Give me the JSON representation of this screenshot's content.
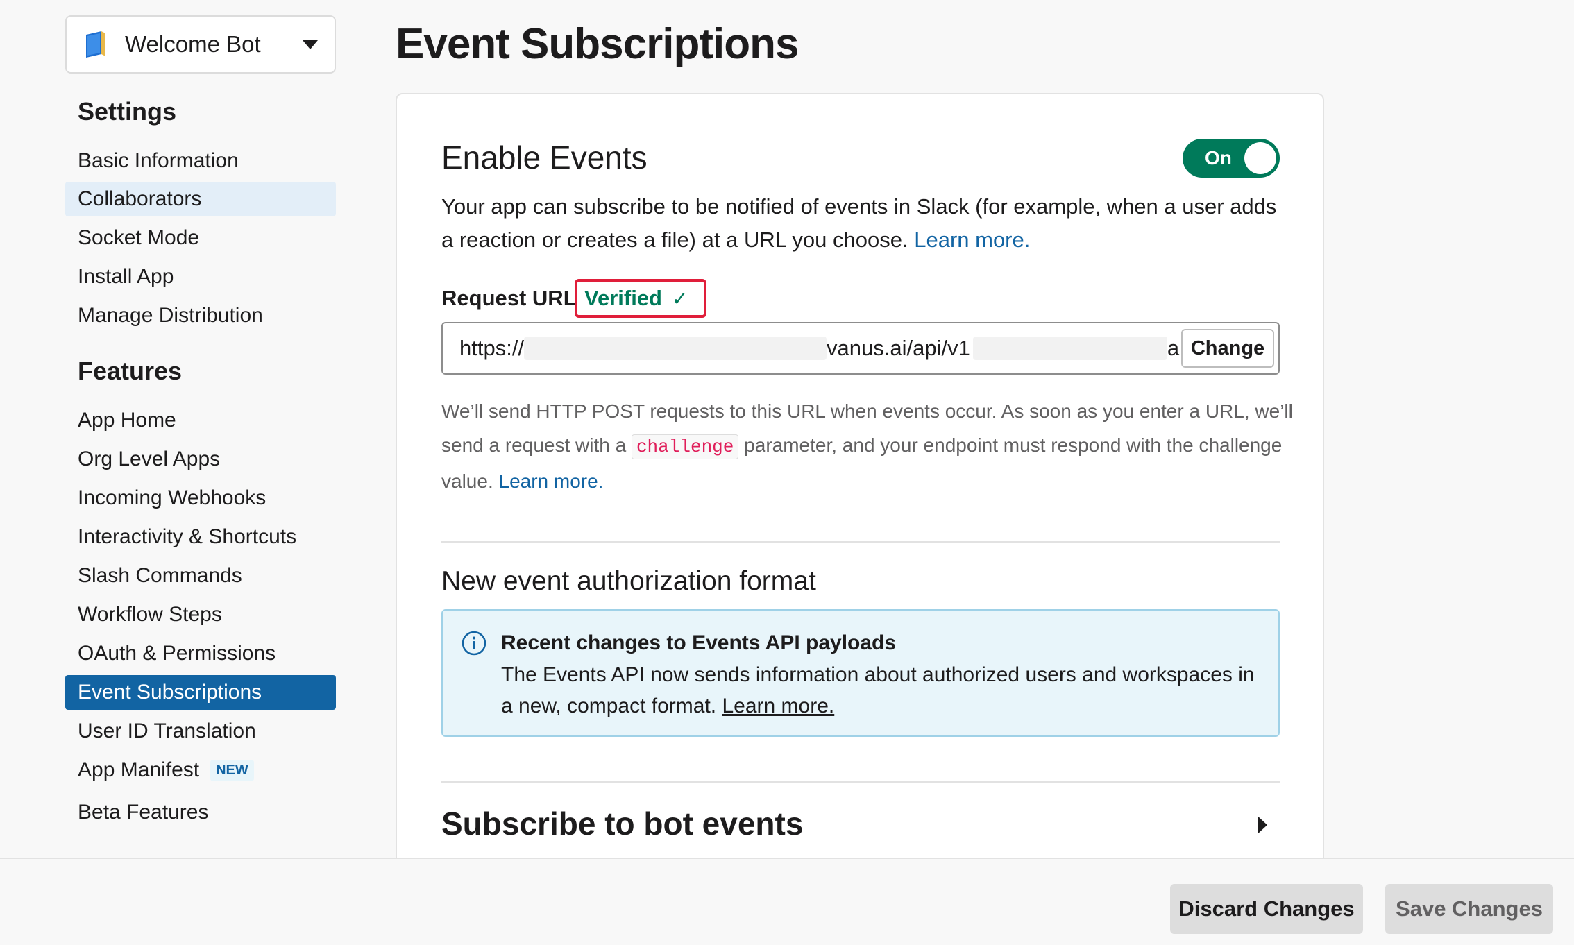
{
  "app_switcher": {
    "name": "Welcome Bot",
    "icon": "book-icon"
  },
  "sidebar": {
    "settings_heading": "Settings",
    "settings_items": [
      {
        "label": "Basic Information"
      },
      {
        "label": "Collaborators"
      },
      {
        "label": "Socket Mode"
      },
      {
        "label": "Install App"
      },
      {
        "label": "Manage Distribution"
      }
    ],
    "features_heading": "Features",
    "features_items": [
      {
        "label": "App Home"
      },
      {
        "label": "Org Level Apps"
      },
      {
        "label": "Incoming Webhooks"
      },
      {
        "label": "Interactivity & Shortcuts"
      },
      {
        "label": "Slash Commands"
      },
      {
        "label": "Workflow Steps"
      },
      {
        "label": "OAuth & Permissions"
      },
      {
        "label": "Event Subscriptions"
      },
      {
        "label": "User ID Translation"
      },
      {
        "label": "App Manifest",
        "badge": "NEW"
      },
      {
        "label": "Beta Features"
      }
    ]
  },
  "main": {
    "title": "Event Subscriptions",
    "enable_events": {
      "title": "Enable Events",
      "toggle_label": "On",
      "description": "Your app can subscribe to be notified of events in Slack (for example, when a user adds a reaction or creates a file) at a URL you choose.",
      "learn_more": "Learn more."
    },
    "request_url": {
      "label": "Request URL",
      "status": "Verified",
      "check": "✓",
      "value_prefix": "https://",
      "value_middle": "vanus.ai/api/v1",
      "value_suffix": "a",
      "change_button": "Change",
      "help_part1": "We’ll send HTTP POST requests to this URL when events occur. As soon as you enter a URL, we’ll send a request with a",
      "help_code": "challenge",
      "help_part2": "parameter, and your endpoint must respond with the challenge value.",
      "help_learn_more": "Learn more."
    },
    "auth_format": {
      "title": "New event authorization format",
      "info_title": "Recent changes to Events API payloads",
      "info_body": "The Events API now sends information about authorized users and workspaces in a new, compact format.",
      "info_learn_more": "Learn more."
    },
    "bot_events": {
      "title": "Subscribe to bot events"
    }
  },
  "footer": {
    "discard_button": "Discard Changes",
    "save_button": "Save Changes"
  },
  "colors": {
    "accent": "#1264a3",
    "toggle_on": "#007a5a",
    "verified": "#007a5a",
    "highlight_border": "#e01e3a"
  }
}
